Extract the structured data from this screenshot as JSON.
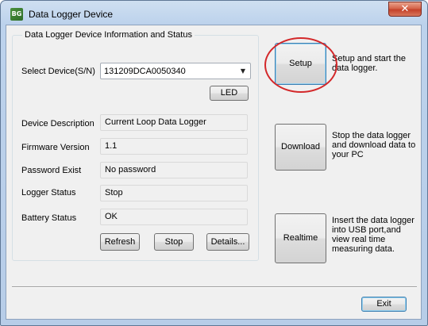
{
  "window": {
    "title": "Data Logger Device",
    "app_icon_text": "BG",
    "close_glyph": "✕"
  },
  "group": {
    "title": "Data Logger Device Information and Status",
    "select_label": "Select Device(S/N)",
    "selected_device": "131209DCA0050340",
    "combo_arrow": "▼",
    "led_button": "LED"
  },
  "fields": [
    {
      "label": "Device Description",
      "value": "Current Loop Data Logger"
    },
    {
      "label": "Firmware Version",
      "value": "1.1"
    },
    {
      "label": "Password Exist",
      "value": "No password"
    },
    {
      "label": "Logger Status",
      "value": "Stop"
    },
    {
      "label": "Battery Status",
      "value": "OK"
    }
  ],
  "buttons": {
    "refresh": "Refresh",
    "stop": "Stop",
    "details": "Details...",
    "exit": "Exit"
  },
  "actions": [
    {
      "label": "Setup",
      "description": "Setup and start the data logger."
    },
    {
      "label": "Download",
      "description": "Stop the data logger and download data to your PC"
    },
    {
      "label": "Realtime",
      "description": "Insert the data logger into USB port,and view real time measuring data."
    }
  ],
  "colors": {
    "highlight_circle": "#d3282a",
    "close_button": "#c4412a"
  }
}
